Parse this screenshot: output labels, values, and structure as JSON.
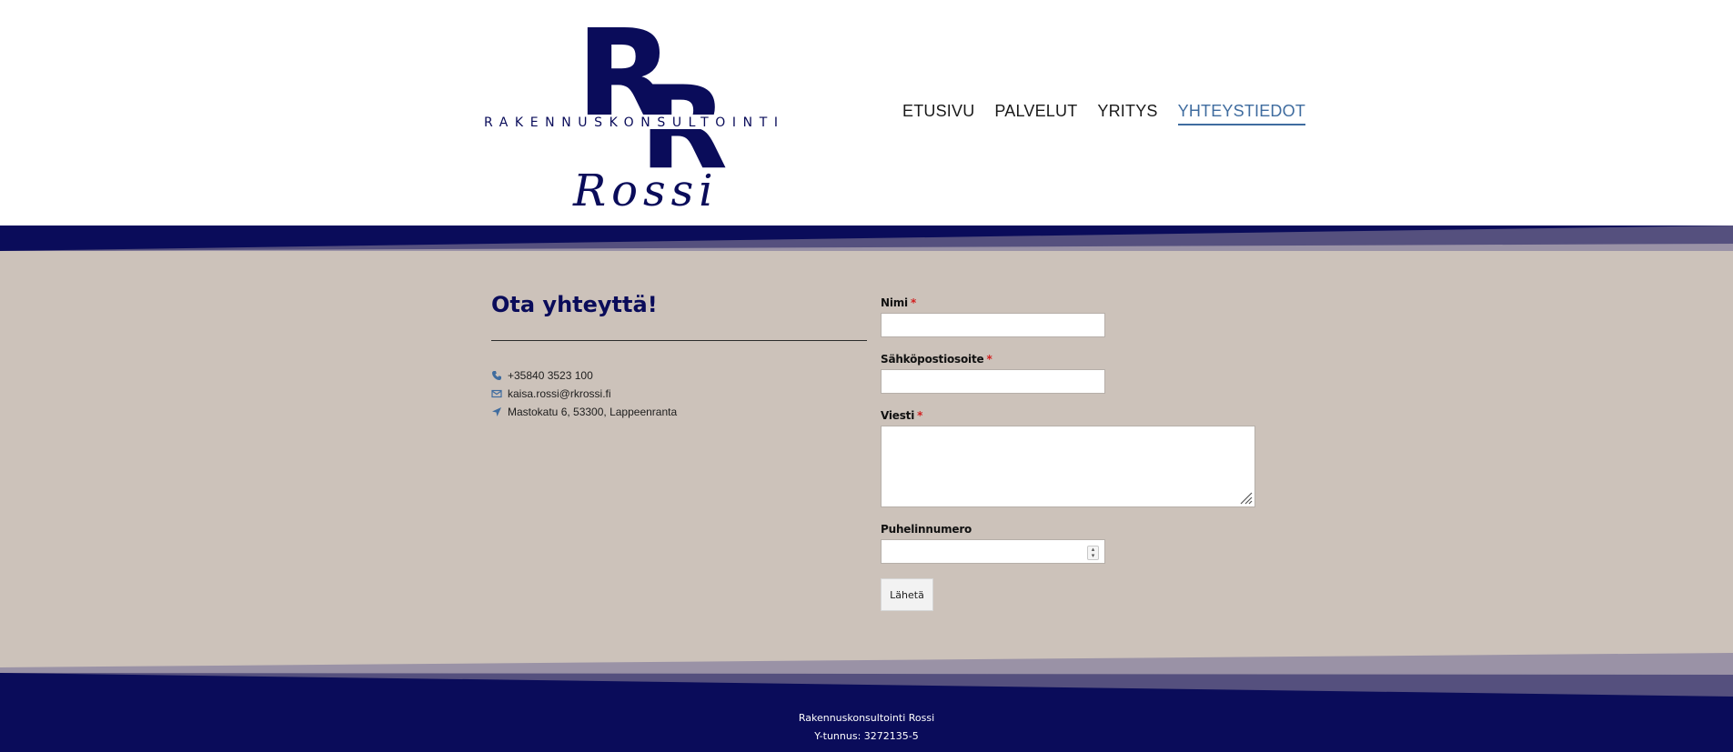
{
  "logo": {
    "mark": "RR",
    "tagline": "RAKENNUSKONSULTOINTI",
    "signature": "Rossi"
  },
  "nav": {
    "items": [
      {
        "label": "ETUSIVU",
        "active": false
      },
      {
        "label": "PALVELUT",
        "active": false
      },
      {
        "label": "YRITYS",
        "active": false
      },
      {
        "label": "YHTEYSTIEDOT",
        "active": true
      }
    ]
  },
  "contact": {
    "title": "Ota yhteyttä!",
    "items": [
      {
        "icon": "phone-icon",
        "text": "+35840 3523 100"
      },
      {
        "icon": "mail-icon",
        "text": "kaisa.rossi@rkrossi.fi"
      },
      {
        "icon": "location-arrow-icon",
        "text": "Mastokatu 6, 53300, Lappeenranta"
      }
    ]
  },
  "form": {
    "name_label": "Nimi",
    "email_label": "Sähköpostiosoite",
    "message_label": "Viesti",
    "phone_label": "Puhelinnumero",
    "required_marker": "*",
    "name_value": "",
    "email_value": "",
    "message_value": "",
    "phone_value": "",
    "submit_label": "Lähetä"
  },
  "footer": {
    "company": "Rakennuskonsultointi Rossi",
    "business_id": "Y-tunnus: 3272135-5"
  },
  "colors": {
    "navy": "#0a0c5a",
    "beige": "#ccc2ba",
    "accent_blue": "#3f6c9f",
    "band_purple": "#55507e",
    "band_grey": "#9a92a6",
    "required_red": "#d21f1f"
  }
}
